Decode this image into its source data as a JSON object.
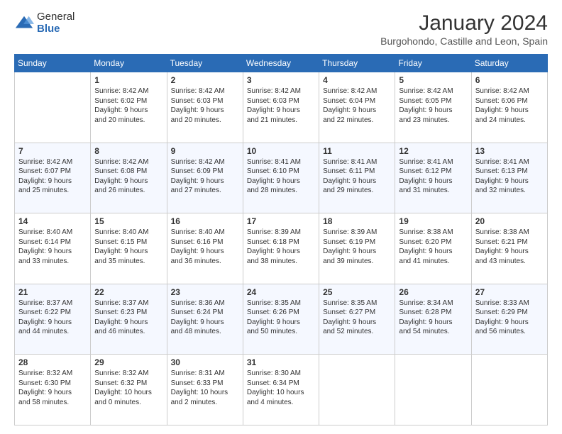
{
  "logo": {
    "general": "General",
    "blue": "Blue"
  },
  "header": {
    "title": "January 2024",
    "subtitle": "Burgohondo, Castille and Leon, Spain"
  },
  "weekdays": [
    "Sunday",
    "Monday",
    "Tuesday",
    "Wednesday",
    "Thursday",
    "Friday",
    "Saturday"
  ],
  "weeks": [
    [
      {
        "day": "",
        "sunrise": "",
        "sunset": "",
        "daylight": ""
      },
      {
        "day": "1",
        "sunrise": "Sunrise: 8:42 AM",
        "sunset": "Sunset: 6:02 PM",
        "daylight": "Daylight: 9 hours and 20 minutes."
      },
      {
        "day": "2",
        "sunrise": "Sunrise: 8:42 AM",
        "sunset": "Sunset: 6:03 PM",
        "daylight": "Daylight: 9 hours and 20 minutes."
      },
      {
        "day": "3",
        "sunrise": "Sunrise: 8:42 AM",
        "sunset": "Sunset: 6:03 PM",
        "daylight": "Daylight: 9 hours and 21 minutes."
      },
      {
        "day": "4",
        "sunrise": "Sunrise: 8:42 AM",
        "sunset": "Sunset: 6:04 PM",
        "daylight": "Daylight: 9 hours and 22 minutes."
      },
      {
        "day": "5",
        "sunrise": "Sunrise: 8:42 AM",
        "sunset": "Sunset: 6:05 PM",
        "daylight": "Daylight: 9 hours and 23 minutes."
      },
      {
        "day": "6",
        "sunrise": "Sunrise: 8:42 AM",
        "sunset": "Sunset: 6:06 PM",
        "daylight": "Daylight: 9 hours and 24 minutes."
      }
    ],
    [
      {
        "day": "7",
        "sunrise": "Sunrise: 8:42 AM",
        "sunset": "Sunset: 6:07 PM",
        "daylight": "Daylight: 9 hours and 25 minutes."
      },
      {
        "day": "8",
        "sunrise": "Sunrise: 8:42 AM",
        "sunset": "Sunset: 6:08 PM",
        "daylight": "Daylight: 9 hours and 26 minutes."
      },
      {
        "day": "9",
        "sunrise": "Sunrise: 8:42 AM",
        "sunset": "Sunset: 6:09 PM",
        "daylight": "Daylight: 9 hours and 27 minutes."
      },
      {
        "day": "10",
        "sunrise": "Sunrise: 8:41 AM",
        "sunset": "Sunset: 6:10 PM",
        "daylight": "Daylight: 9 hours and 28 minutes."
      },
      {
        "day": "11",
        "sunrise": "Sunrise: 8:41 AM",
        "sunset": "Sunset: 6:11 PM",
        "daylight": "Daylight: 9 hours and 29 minutes."
      },
      {
        "day": "12",
        "sunrise": "Sunrise: 8:41 AM",
        "sunset": "Sunset: 6:12 PM",
        "daylight": "Daylight: 9 hours and 31 minutes."
      },
      {
        "day": "13",
        "sunrise": "Sunrise: 8:41 AM",
        "sunset": "Sunset: 6:13 PM",
        "daylight": "Daylight: 9 hours and 32 minutes."
      }
    ],
    [
      {
        "day": "14",
        "sunrise": "Sunrise: 8:40 AM",
        "sunset": "Sunset: 6:14 PM",
        "daylight": "Daylight: 9 hours and 33 minutes."
      },
      {
        "day": "15",
        "sunrise": "Sunrise: 8:40 AM",
        "sunset": "Sunset: 6:15 PM",
        "daylight": "Daylight: 9 hours and 35 minutes."
      },
      {
        "day": "16",
        "sunrise": "Sunrise: 8:40 AM",
        "sunset": "Sunset: 6:16 PM",
        "daylight": "Daylight: 9 hours and 36 minutes."
      },
      {
        "day": "17",
        "sunrise": "Sunrise: 8:39 AM",
        "sunset": "Sunset: 6:18 PM",
        "daylight": "Daylight: 9 hours and 38 minutes."
      },
      {
        "day": "18",
        "sunrise": "Sunrise: 8:39 AM",
        "sunset": "Sunset: 6:19 PM",
        "daylight": "Daylight: 9 hours and 39 minutes."
      },
      {
        "day": "19",
        "sunrise": "Sunrise: 8:38 AM",
        "sunset": "Sunset: 6:20 PM",
        "daylight": "Daylight: 9 hours and 41 minutes."
      },
      {
        "day": "20",
        "sunrise": "Sunrise: 8:38 AM",
        "sunset": "Sunset: 6:21 PM",
        "daylight": "Daylight: 9 hours and 43 minutes."
      }
    ],
    [
      {
        "day": "21",
        "sunrise": "Sunrise: 8:37 AM",
        "sunset": "Sunset: 6:22 PM",
        "daylight": "Daylight: 9 hours and 44 minutes."
      },
      {
        "day": "22",
        "sunrise": "Sunrise: 8:37 AM",
        "sunset": "Sunset: 6:23 PM",
        "daylight": "Daylight: 9 hours and 46 minutes."
      },
      {
        "day": "23",
        "sunrise": "Sunrise: 8:36 AM",
        "sunset": "Sunset: 6:24 PM",
        "daylight": "Daylight: 9 hours and 48 minutes."
      },
      {
        "day": "24",
        "sunrise": "Sunrise: 8:35 AM",
        "sunset": "Sunset: 6:26 PM",
        "daylight": "Daylight: 9 hours and 50 minutes."
      },
      {
        "day": "25",
        "sunrise": "Sunrise: 8:35 AM",
        "sunset": "Sunset: 6:27 PM",
        "daylight": "Daylight: 9 hours and 52 minutes."
      },
      {
        "day": "26",
        "sunrise": "Sunrise: 8:34 AM",
        "sunset": "Sunset: 6:28 PM",
        "daylight": "Daylight: 9 hours and 54 minutes."
      },
      {
        "day": "27",
        "sunrise": "Sunrise: 8:33 AM",
        "sunset": "Sunset: 6:29 PM",
        "daylight": "Daylight: 9 hours and 56 minutes."
      }
    ],
    [
      {
        "day": "28",
        "sunrise": "Sunrise: 8:32 AM",
        "sunset": "Sunset: 6:30 PM",
        "daylight": "Daylight: 9 hours and 58 minutes."
      },
      {
        "day": "29",
        "sunrise": "Sunrise: 8:32 AM",
        "sunset": "Sunset: 6:32 PM",
        "daylight": "Daylight: 10 hours and 0 minutes."
      },
      {
        "day": "30",
        "sunrise": "Sunrise: 8:31 AM",
        "sunset": "Sunset: 6:33 PM",
        "daylight": "Daylight: 10 hours and 2 minutes."
      },
      {
        "day": "31",
        "sunrise": "Sunrise: 8:30 AM",
        "sunset": "Sunset: 6:34 PM",
        "daylight": "Daylight: 10 hours and 4 minutes."
      },
      {
        "day": "",
        "sunrise": "",
        "sunset": "",
        "daylight": ""
      },
      {
        "day": "",
        "sunrise": "",
        "sunset": "",
        "daylight": ""
      },
      {
        "day": "",
        "sunrise": "",
        "sunset": "",
        "daylight": ""
      }
    ]
  ]
}
